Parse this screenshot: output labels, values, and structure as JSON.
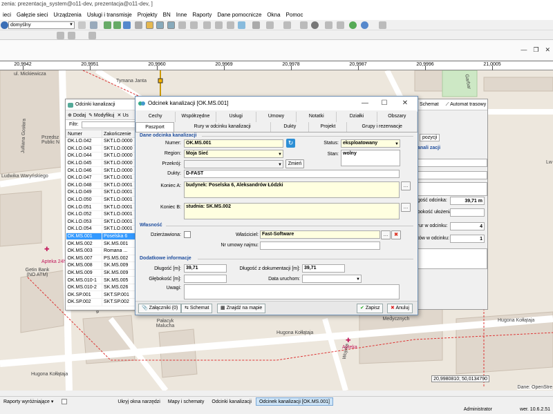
{
  "app": {
    "title_text": "zenia: prezentacja_system@o11-dev, prezentacja@o11-dev, ]"
  },
  "menu": [
    "ieci",
    "Gałęzie sieci",
    "Urządzenia",
    "Usługi i transmisje",
    "Projekty",
    "BN",
    "Inne",
    "Raporty",
    "Dane pomocnicze",
    "Okna",
    "Pomoc"
  ],
  "toolbar": {
    "scheme_select": "domyślny"
  },
  "ruler": {
    "labels": [
      "20,9942",
      "20,9951",
      "20,9960",
      "20,9969",
      "20,9978",
      "20,9987",
      "20,9996",
      "21,0005"
    ]
  },
  "map": {
    "streets": [
      "ul. Mickiewicza",
      "Tymana Janta",
      "Julliana Gosłara",
      "Ludwika Waryńskiego",
      "Hugona Kołłątaja",
      "Hugona Kołłątaja",
      "Hugona Kołłątaja",
      "Wojska",
      "Sienna",
      "Garbar"
    ],
    "pois": [
      "Przedsz Public N",
      "Getin Bank (NO ATM)",
      "Apteka 24h",
      "Pałacyk Malucha",
      "Zespół Szkół Medycznych",
      "Apteka",
      "Lw"
    ],
    "coord_readout": "20,9980810; 50,0134790",
    "credit": "Dane: OpenStre"
  },
  "list_window": {
    "title": "Odcinki kanalizacji",
    "toolbar": [
      "Dodaj",
      "Modyfikuj",
      "Us"
    ],
    "filter_label": "Filtr:",
    "columns": [
      "Numer",
      "Zakończenie"
    ],
    "rows": [
      [
        "OK.LO.042",
        "SKT.LO.0000"
      ],
      [
        "OK.LO.043",
        "SKT.LO.0000"
      ],
      [
        "OK.LO.044",
        "SKT.LO.0000"
      ],
      [
        "OK.LO.045",
        "SKT.LO.0000"
      ],
      [
        "OK.LO.046",
        "SKT.LO.0000"
      ],
      [
        "OK.LO.047",
        "SKT.LO.0001"
      ],
      [
        "OK.LO.048",
        "SKT.LO.0001"
      ],
      [
        "OK.LO.049",
        "SKT.LO.0001"
      ],
      [
        "OK.LO.050",
        "SKT.LO.0001"
      ],
      [
        "OK.LO.051",
        "SKT.LO.0001"
      ],
      [
        "OK.LO.052",
        "SKT.LO.0001"
      ],
      [
        "OK.LO.053",
        "SKT.LO.0001"
      ],
      [
        "OK.LO.054",
        "SKT.LO.0001"
      ],
      [
        "OK.MS.001",
        "Poselska 6"
      ],
      [
        "OK.MS.002",
        "SK.MS.001"
      ],
      [
        "OK.MS.003",
        "Romana ..."
      ],
      [
        "OK.MS.007",
        "PS.MS.002"
      ],
      [
        "OK.MS.008",
        "SK.MS.009"
      ],
      [
        "OK.MS.009",
        "SK.MS.009"
      ],
      [
        "OK.MS.010-1",
        "SK.MS.005"
      ],
      [
        "OK.MS.010-2",
        "SK.MS.026"
      ],
      [
        "OK.SP.001",
        "SKT.SP.001"
      ],
      [
        "OK.SP.002",
        "SKT.SP.002"
      ]
    ],
    "selected_index": 13
  },
  "right_window": {
    "tabs": [
      "Schemat",
      "Automat trasowy"
    ],
    "poz_label": "pozycji",
    "section": "anali zacji",
    "rows": [
      {
        "label": "gość odcinka:",
        "value": "39,71 m"
      },
      {
        "label": "bokość ułożenia:",
        "value": ""
      },
      {
        "label": "rur w odcinku:",
        "value": "4"
      },
      {
        "label": "tów w odcinku:",
        "value": "1"
      }
    ]
  },
  "dialog": {
    "title": "Odcinek kanalizacji [OK.MS.001]",
    "tabs_row1": [
      "Cechy",
      "Współrzędne",
      "Usługi",
      "Umowy",
      "Notatki",
      "Działki",
      "Obszary"
    ],
    "tabs_row2": [
      "Paszport",
      "Rury w odcinku kanalizacji",
      "Dukty",
      "Projekt",
      "Grupy i rezerwacje"
    ],
    "section_basic": "Dane odcinka kanalizacji",
    "numer_label": "Numer:",
    "numer_value": "OK.MS.001",
    "region_label": "Region:",
    "region_value": "Moja Sieć",
    "przekroj_label": "Przekrój:",
    "przekroj_value": "",
    "zmien_label": "Zmień",
    "dukty_label": "Dukty:",
    "dukty_value": "D-FAST",
    "koniec_a_label": "Koniec A:",
    "koniec_a_value": "budynek: Poselska 6, Aleksandrów Łódzki",
    "koniec_b_label": "Koniec B:",
    "koniec_b_value": "studnia: SK.MS.002",
    "status_label": "Status:",
    "status_value": "eksploatowany",
    "stan_label": "Stan:",
    "stan_value": "wolny",
    "section_owner": "Własność",
    "dzierzawiona_label": "Dzierżawiona:",
    "wlasciciel_label": "Właściciel:",
    "wlasciciel_value": "Fast-Software",
    "nr_umowy_label": "Nr umowy najmu:",
    "nr_umowy_value": "",
    "section_extra": "Dodatkowe informacje",
    "dlugosc_label": "Długość [m]:",
    "dlugosc_value": "39,71",
    "dlugosc_dok_label": "Długość z dokumentacji [m]:",
    "dlugosc_dok_value": "39,71",
    "glebokosc_label": "Głębokość [m]:",
    "glebokosc_value": "",
    "data_uruchom_label": "Data uruchom:",
    "data_uruchom_value": "",
    "uwagi_label": "Uwagi:",
    "uwagi_value": "",
    "footer": {
      "zalaczniki": "Załączniki (0)",
      "schemat": "Schemat",
      "znajdz": "Znajdź na mapie",
      "zapisz": "Zapisz",
      "anuluj": "Anuluj"
    }
  },
  "statusbar": {
    "raporty": "Raporty wyróżniające",
    "ukryj": "Ukryj okna narzędzi",
    "tasks": [
      "Mapy i schematy",
      "Odcinki kanalizacji",
      "Odcinek kanalizacji [OK.MS.001]"
    ],
    "active_task_index": 2,
    "user": "Administrator",
    "version": "wer. 10.6.2.51"
  },
  "colors": {
    "selection": "#3399ff",
    "highlight_field": "#ffffe0",
    "section_title": "#1f4e9e",
    "map_bg": "#ede7dd"
  }
}
